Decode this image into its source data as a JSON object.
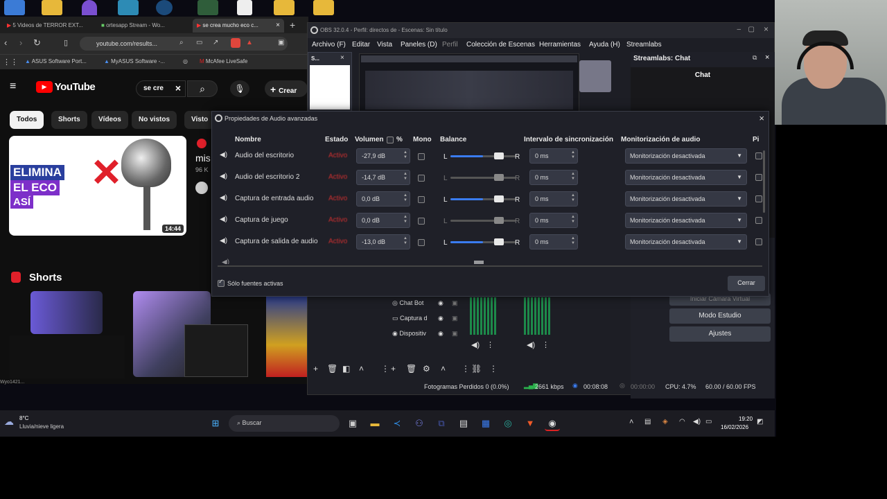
{
  "browser": {
    "tabs": [
      "5 Videos de TERROR EXT...",
      "ortesapp Stream - Wo...",
      "se crea mucho eco c..."
    ],
    "url": "youtube.com/results...",
    "bookmarks": [
      "ASUS Software Port...",
      "MyASUS Software -...",
      "McAfee LiveSafe"
    ],
    "yt_logo": "YouTube",
    "search_value": "se cre",
    "create_label": "Crear",
    "chips": [
      "Todos",
      "Shorts",
      "Vídeos",
      "No vistos",
      "Visto"
    ],
    "thumb_text": [
      "ELIMINA",
      "EL ECO",
      "ASÍ"
    ],
    "thumb_duration": "14:44",
    "video_title_partial": "mis",
    "video_meta_partial": "96 K",
    "shorts_label": "Shorts",
    "status_partial": "Wyo1421..."
  },
  "obs": {
    "title": "OBS 32.0.4 - Perfil: directos de - Escenas: Sin título",
    "menu": [
      "Archivo (F)",
      "Editar",
      "Vista",
      "Paneles (D)",
      "Perfil",
      "Colección de Escenas",
      "Herramientas",
      "Ayuda (H)",
      "Streamlabs"
    ],
    "chat_panel_title": "Streamlabs: Chat",
    "chat_label": "Chat",
    "sources": [
      "Chat Bot",
      "Captura d",
      "Dispositiv"
    ],
    "buttons": {
      "studio_mode": "Modo Estudio",
      "settings": "Ajustes",
      "virtual_cam": "Iniciar Cámara Virtual"
    },
    "status": {
      "dropped": "Fotogramas Perdidos 0 (0.0%)",
      "kbps": "2661 kbps",
      "rec_time": "00:08:08",
      "stream_time": "00:00:00",
      "cpu": "CPU: 4.7%",
      "fps": "60.00 / 60.00 FPS"
    }
  },
  "dialog": {
    "title": "Propiedades de Audio avanzadas",
    "headers": {
      "name": "Nombre",
      "state": "Estado",
      "volume": "Volumen",
      "percent": "%",
      "mono": "Mono",
      "balance": "Balance",
      "sync": "Intervalo de sincronización",
      "monitor": "Monitorización de audio",
      "tracks": "Pi"
    },
    "rows": [
      {
        "name": "Audio del escritorio",
        "state": "Activo",
        "volume": "-27,9 dB",
        "balance": 0.5,
        "active": true,
        "sync": "0 ms",
        "monitor": "Monitorización desactivada"
      },
      {
        "name": "Audio del escritorio 2",
        "state": "Activo",
        "volume": "-14,7 dB",
        "balance": 0.5,
        "active": false,
        "sync": "0 ms",
        "monitor": "Monitorización desactivada"
      },
      {
        "name": "Captura de entrada audio",
        "state": "Activo",
        "volume": "0,0 dB",
        "balance": 0.5,
        "active": true,
        "sync": "0 ms",
        "monitor": "Monitorización desactivada"
      },
      {
        "name": "Captura de juego",
        "state": "Activo",
        "volume": "0,0 dB",
        "balance": 0.5,
        "active": false,
        "sync": "0 ms",
        "monitor": "Monitorización desactivada"
      },
      {
        "name": "Captura de salida de audio",
        "state": "Activo",
        "volume": "-13,0 dB",
        "balance": 0.5,
        "active": true,
        "sync": "0 ms",
        "monitor": "Monitorización desactivada"
      }
    ],
    "balance_L": "L",
    "balance_R": "R",
    "only_active_label": "Sólo fuentes activas",
    "close_label": "Cerrar"
  },
  "taskbar": {
    "weather_temp": "8°C",
    "weather_desc": "Lluvia/nieve ligera",
    "search_label": "Buscar",
    "time": "19:20",
    "date": "16/02/2026"
  },
  "colors": {
    "accent": "#3a7cf0",
    "state_red": "#d03030",
    "yt_red": "#ff0000"
  }
}
